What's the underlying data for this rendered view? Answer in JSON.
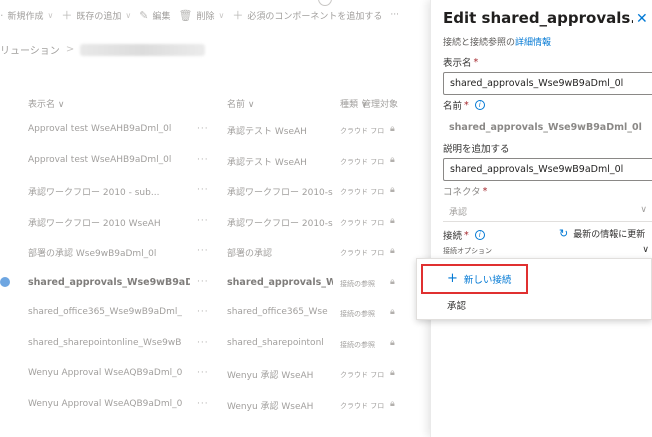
{
  "commandbar": {
    "new_label": "新規作成",
    "add_existing_label": "既存の追加",
    "edit_label": "編集",
    "delete_label": "削除",
    "add_required_label": "必須のコンポーネントを追加する",
    "more": "···"
  },
  "breadcrumb": {
    "root": "リューション",
    "separator": ">"
  },
  "table": {
    "headers": [
      "表示名",
      "名前",
      "種類",
      "管理対象"
    ],
    "rows": [
      {
        "display": "Approval test WseAHB9aDml_0l",
        "name": "承認テスト WseAH",
        "type": "クラウド フロー",
        "selected": false
      },
      {
        "display": "Approval test WseAHB9aDml_0l",
        "name": "承認テスト WseAH",
        "type": "クラウド フロー",
        "selected": false
      },
      {
        "display": "承認ワークフロー 2010 - sub...",
        "name": "承認ワークフロー 2010-sul",
        "type": "クラウド フロー",
        "selected": false
      },
      {
        "display": "承認ワークフロー 2010 WseAH",
        "name": "承認ワークフロー 2010-sul",
        "type": "クラウド フロー",
        "selected": false
      },
      {
        "display": "部署の承認 Wse9wB9aDml_0l",
        "name": "部署の承認",
        "type": "クラウド フロー",
        "selected": false
      },
      {
        "display": "shared_approvals_Wse9wB9aD",
        "name": "shared_approvals_W",
        "type": "接続の参照",
        "selected": true
      },
      {
        "display": "shared_office365_Wse9wB9aDml_",
        "name": "shared_office365_Wse",
        "type": "接続の参照",
        "selected": false
      },
      {
        "display": "shared_sharepointonline_Wse9wB",
        "name": "shared_sharepointonl",
        "type": "接続の参照",
        "selected": false
      },
      {
        "display": "Wenyu Approval WseAQB9aDml_0",
        "name": "Wenyu 承認 WseAH",
        "type": "クラウド フロー",
        "selected": false
      },
      {
        "display": "Wenyu Approval WseAQB9aDml_0",
        "name": "Wenyu 承認 WseAH",
        "type": "クラウド フロー",
        "selected": false
      }
    ]
  },
  "panel": {
    "title": "Edit shared_approvals...",
    "subtitle_prefix": "接続と接続参照の",
    "subtitle_link": "詳細情報",
    "display_name_label": "表示名",
    "display_name_value": "shared_approvals_Wse9wB9aDml_0l",
    "name_label": "名前",
    "name_value": "shared_approvals_Wse9wB9aDml_0l",
    "description_label": "説明を追加する",
    "description_value": "shared_approvals_Wse9wB9aDml_0l",
    "connector_label": "コネクタ",
    "connector_value": "承認",
    "connection_label": "接続",
    "refresh_label": "最新の情報に更新",
    "connection_placeholder": "接続オプション",
    "menu_new_connection": "新しい接続",
    "menu_item_approval": "承認",
    "required_mark": "*"
  },
  "colors": {
    "accent": "#0078d4",
    "highlight_border": "#e03030",
    "required": "#a4262c"
  }
}
